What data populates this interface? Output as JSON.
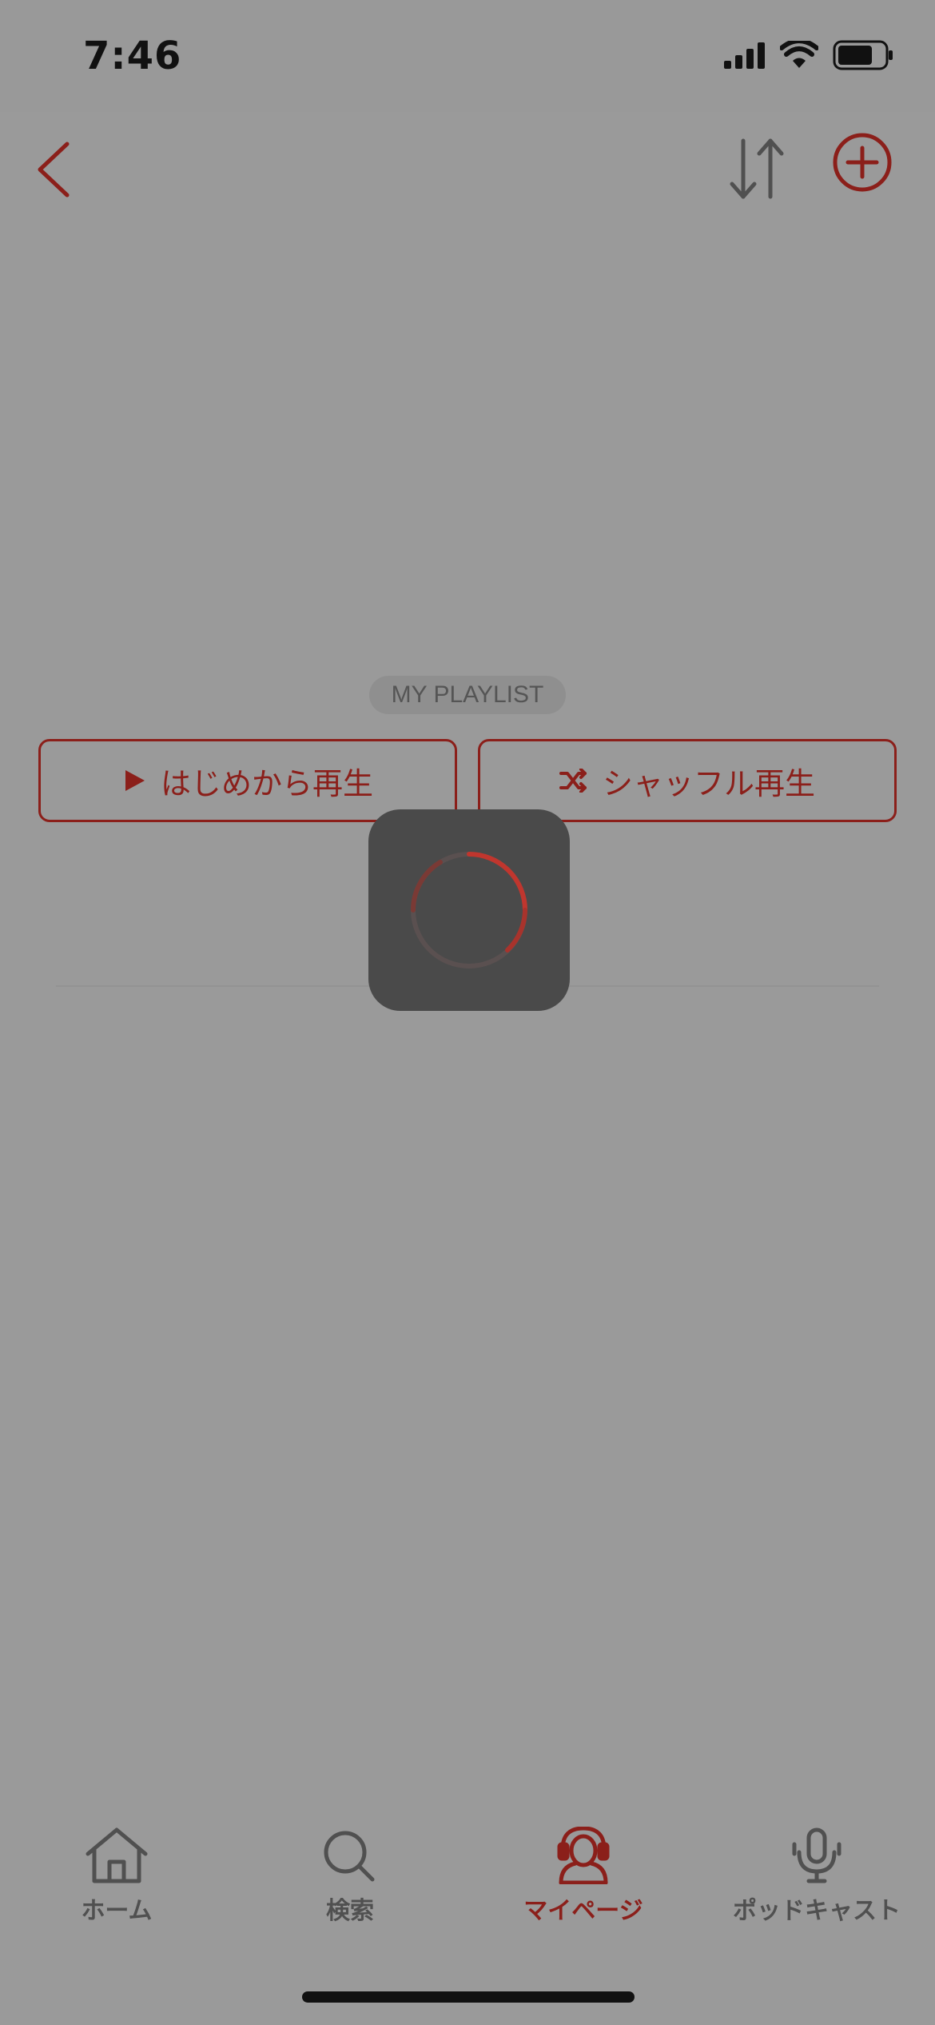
{
  "status_bar": {
    "time": "7:46"
  },
  "nav": {
    "back_icon": "chevron-left-icon",
    "sort_icon": "sort-arrows-icon",
    "add_icon": "plus-circle-icon"
  },
  "playlist": {
    "tag": "MY PLAYLIST",
    "play_from_start": "はじめから再生",
    "shuffle_play": "シャッフル再生"
  },
  "loading": {
    "icon": "spinner-icon"
  },
  "tab_bar": {
    "items": [
      {
        "label": "ホーム",
        "icon": "home-icon"
      },
      {
        "label": "検索",
        "icon": "search-icon"
      },
      {
        "label": "マイページ",
        "icon": "headphones-user-icon",
        "active": true
      },
      {
        "label": "ポッドキャスト",
        "icon": "microphone-icon"
      }
    ]
  },
  "colors": {
    "accent": "#8b1f1a",
    "overlay": "#9a9a9a",
    "loader_bg": "#4a4a4a"
  }
}
